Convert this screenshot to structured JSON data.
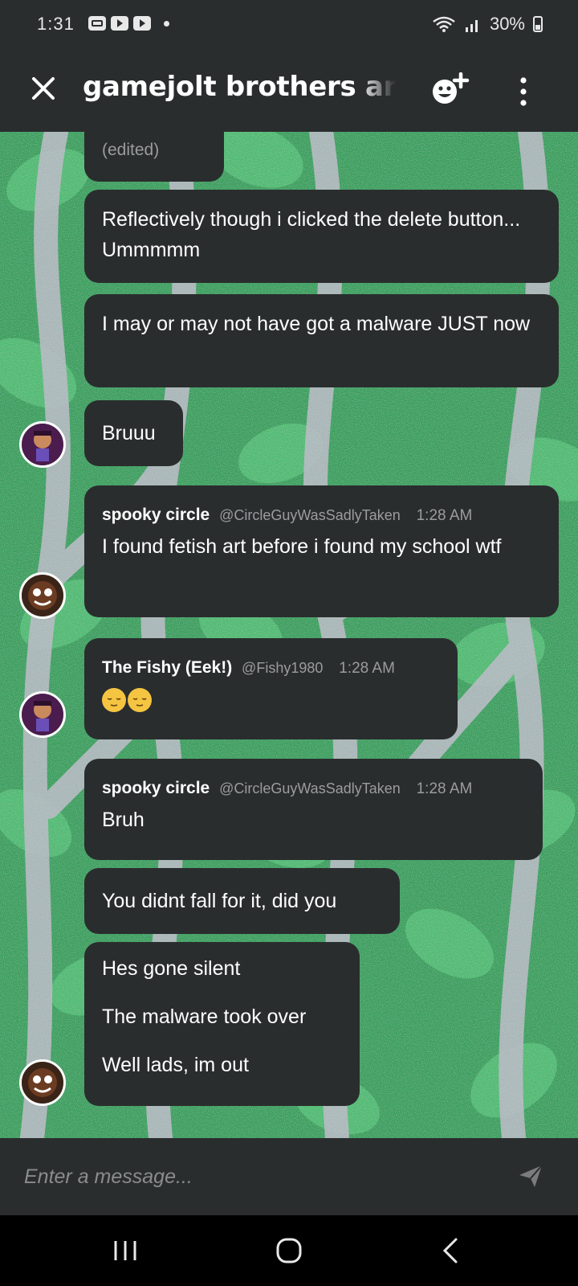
{
  "status_bar": {
    "time": "1:31",
    "battery": "30%",
    "icons": [
      "gallery-icon",
      "youtube-icon",
      "youtube-icon",
      "dot-icon",
      "wifi-icon",
      "signal-icon",
      "battery-icon"
    ]
  },
  "header": {
    "title": "gamejolt brothers and sisters",
    "close_icon": "close-icon",
    "emoji_add_icon": "add-reaction-icon",
    "more_icon": "more-vertical-icon"
  },
  "colors": {
    "bar_bg": "#2a2d2e",
    "bubble_bg": "#2a2d2e",
    "chat_bg_green": "#3a9e5c",
    "muted_text": "#9a9c9e"
  },
  "messages": [
    {
      "edited_label": "(edited)"
    },
    {
      "text": "Reflectively though i clicked the delete button... Ummmmm"
    },
    {
      "text": "I may or may not have got a malware JUST now"
    },
    {
      "text": "Bruuu"
    },
    {
      "author": "spooky circle",
      "handle": "@CircleGuyWasSadlyTaken",
      "time": "1:28 AM",
      "text": "I found fetish art before i found my school wtf"
    },
    {
      "author": "The Fishy (Eek!)",
      "handle": "@Fishy1980",
      "time": "1:28 AM",
      "emoji": [
        "relieved-face-emoji",
        "relieved-face-emoji"
      ]
    },
    {
      "author": "spooky circle",
      "handle": "@CircleGuyWasSadlyTaken",
      "time": "1:28 AM",
      "text": "Bruh"
    },
    {
      "text": "You didnt fall for it, did you"
    },
    {
      "lines": [
        "Hes gone silent",
        "The malware took over",
        "Well lads, im out"
      ]
    }
  ],
  "composer": {
    "placeholder": "Enter a message...",
    "send_icon": "send-icon"
  },
  "nav": {
    "icons": [
      "recent-apps-icon",
      "home-icon",
      "back-icon"
    ]
  }
}
